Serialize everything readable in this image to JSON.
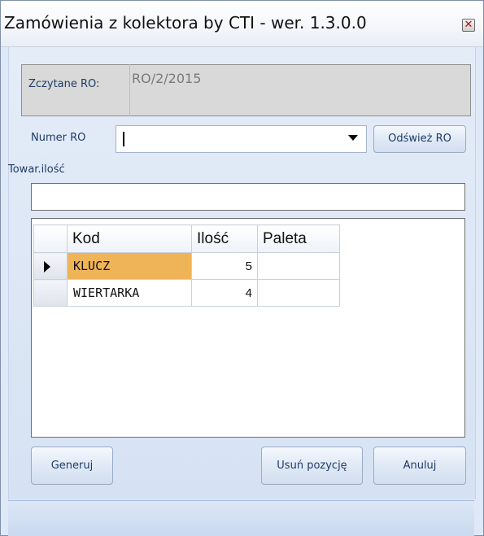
{
  "window": {
    "title": "Zamówienia z kolektora by CTI -  wer. 1.3.0.0",
    "close_icon": "close-icon"
  },
  "form": {
    "ro_read_label": "Zczytane RO:",
    "ro_read_value": "RO/2/2015",
    "numer_ro_label": "Numer RO",
    "numer_ro_value": "",
    "refresh_button": "Odśwież RO",
    "towar_label": "Towar.ilość",
    "towar_value": ""
  },
  "grid": {
    "columns": [
      "Kod",
      "Ilość",
      "Paleta"
    ],
    "rows": [
      {
        "kod": "KLUCZ",
        "ilosc": "5",
        "paleta": "",
        "current": true
      },
      {
        "kod": "WIERTARKA",
        "ilosc": "4",
        "paleta": "",
        "current": false
      }
    ]
  },
  "buttons": {
    "generate": "Generuj",
    "delete_item": "Usuń pozycję",
    "cancel": "Anuluj"
  },
  "colors": {
    "selected_cell": "#f0b458",
    "panel_background": "#dfe8f6"
  }
}
